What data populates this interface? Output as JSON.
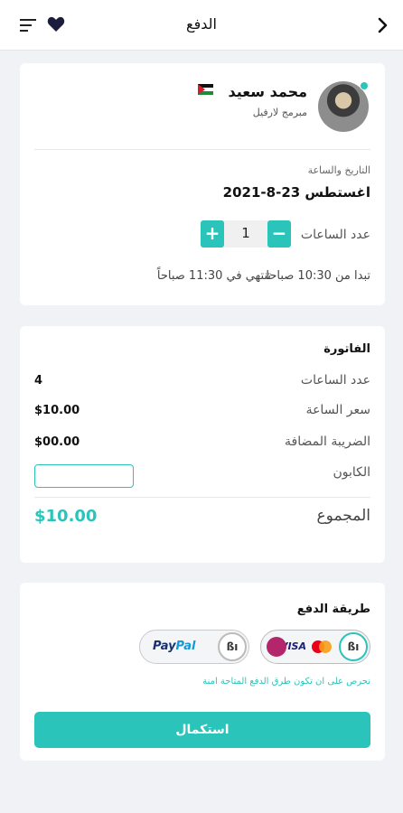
{
  "header": {
    "title": "الدفع",
    "back_icon": "chevron-right-icon",
    "menu_icon": "menu-icon",
    "heart_icon": "heart-icon"
  },
  "teacher": {
    "name": "محمد سعيد",
    "role": "مبرمج لارفيل",
    "flag": "jordan-flag-icon"
  },
  "booking": {
    "date_label": "التاريخ والساعة",
    "date_value": "اغستطس 23-8-2021",
    "hours_label": "عدد الساعات",
    "hours_value": "1",
    "plus": "+",
    "minus": "−",
    "start_text": "تبدا من 10:30 صباحا",
    "end_text": "تنتهي في 11:30 صباحاً"
  },
  "invoice": {
    "title": "الفاتورة",
    "rows": [
      {
        "label": "عدد الساعات",
        "value": "4"
      },
      {
        "label": "سعر الساعة",
        "value": "$10.00"
      },
      {
        "label": "الضريبة المضافة",
        "value": "$00.00"
      }
    ],
    "coupon_label": "الكابون",
    "coupon_value": "",
    "total_label": "المجموع",
    "total_value": "$10.00"
  },
  "payment": {
    "title": "طريقة الدفع",
    "options": [
      {
        "name": "visa-mastercard",
        "badge": "ßı",
        "label": "VISA"
      },
      {
        "name": "paypal",
        "badge": "ßı",
        "label_a": "Pay",
        "label_b": "Pal"
      }
    ],
    "note": "نحرص على ان تكون طرق الدفع المتاحة امنة",
    "submit_label": "استكمال"
  },
  "colors": {
    "accent": "#2bc4bb",
    "background": "#f1f2f5",
    "card": "#ffffff"
  }
}
